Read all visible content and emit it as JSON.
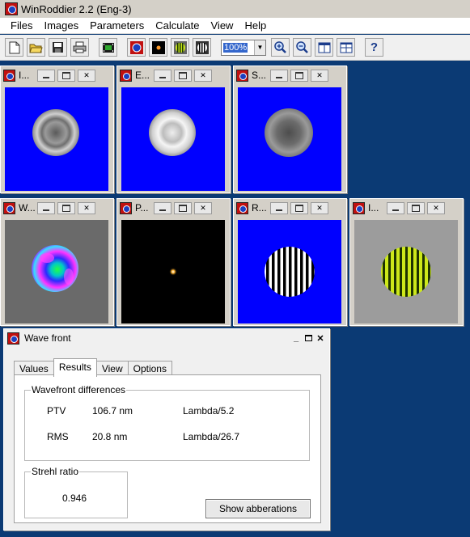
{
  "app": {
    "title": "WinRoddier 2.2 (Eng-3)"
  },
  "menu": [
    "Files",
    "Images",
    "Parameters",
    "Calculate",
    "View",
    "Help"
  ],
  "toolbar": {
    "zoom": "100%",
    "help": "?"
  },
  "windows": [
    {
      "name": "I..."
    },
    {
      "name": "E..."
    },
    {
      "name": "S..."
    },
    {
      "name": "W..."
    },
    {
      "name": "P..."
    },
    {
      "name": "R..."
    },
    {
      "name": "I..."
    }
  ],
  "wavefront": {
    "title": "Wave front",
    "tabs": [
      "Values",
      "Results",
      "View",
      "Options"
    ],
    "active_tab": "Results",
    "diff_group": "Wavefront differences",
    "rows": [
      {
        "label": "PTV",
        "value": "106.7 nm",
        "lambda": "Lambda/5.2"
      },
      {
        "label": "RMS",
        "value": "20.8 nm",
        "lambda": "Lambda/26.7"
      }
    ],
    "strehl_group": "Strehl ratio",
    "strehl_value": "0.946",
    "button": "Show abberations"
  },
  "colors": {
    "desktop": "#0b3a74",
    "image_bg_blue": "#0000ff",
    "psf_bg": "#000000",
    "fringe_bg": "#9c9c9c",
    "fringe_yellow": "#cde81a"
  }
}
